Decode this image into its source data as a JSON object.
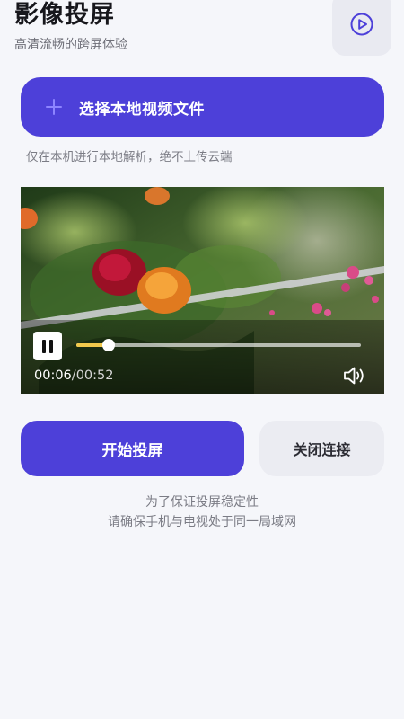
{
  "header": {
    "title": "影像投屏",
    "subtitle": "高清流畅的跨屏体验",
    "corner_button_icon": "play-circle-icon"
  },
  "select_button": {
    "label": "选择本地视频文件",
    "icon": "plus-icon"
  },
  "hint": "仅在本机进行本地解析，绝不上传云端",
  "player": {
    "current_time": "00:06",
    "separator": "/",
    "duration": "00:52",
    "progress": 0.115,
    "pause_icon": "pause-icon",
    "volume_icon": "volume-icon"
  },
  "actions": {
    "start_label": "开始投屏",
    "close_label": "关闭连接"
  },
  "tip": {
    "line1": "为了保证投屏稳定性",
    "line2": "请确保手机与电视处于同一局域网"
  },
  "colors": {
    "accent": "#4d40d9",
    "progress": "#f2c94c",
    "background": "#f5f6fa"
  }
}
